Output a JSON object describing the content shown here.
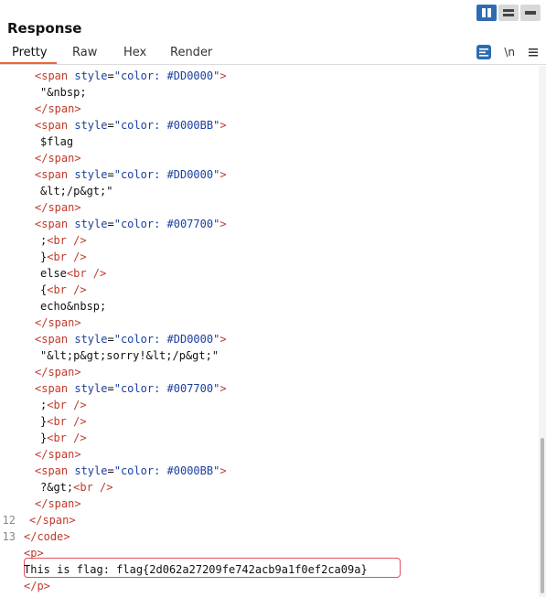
{
  "panel": {
    "title": "Response"
  },
  "layout_buttons": [
    {
      "name": "split-columns"
    },
    {
      "name": "split-rows"
    },
    {
      "name": "single-pane"
    }
  ],
  "tabs": [
    {
      "label": "Pretty",
      "active": true
    },
    {
      "label": "Raw",
      "active": false
    },
    {
      "label": "Hex",
      "active": false
    },
    {
      "label": "Render",
      "active": false
    }
  ],
  "tools": {
    "newline_label": "\\n"
  },
  "code_lines": [
    {
      "ln": "",
      "indent": 2,
      "parts": [
        [
          "tag",
          "<span "
        ],
        [
          "attr",
          "style"
        ],
        [
          "plain",
          "="
        ],
        [
          "str",
          "\"color: #DD0000\""
        ],
        [
          "tag",
          ">"
        ]
      ]
    },
    {
      "ln": "",
      "indent": 3,
      "parts": [
        [
          "txt",
          "\"&nbsp;"
        ]
      ]
    },
    {
      "ln": "",
      "indent": 2,
      "parts": [
        [
          "tag",
          "</span>"
        ]
      ]
    },
    {
      "ln": "",
      "indent": 2,
      "parts": [
        [
          "tag",
          "<span "
        ],
        [
          "attr",
          "style"
        ],
        [
          "plain",
          "="
        ],
        [
          "str",
          "\"color: #0000BB\""
        ],
        [
          "tag",
          ">"
        ]
      ]
    },
    {
      "ln": "",
      "indent": 3,
      "parts": [
        [
          "txt",
          "$flag"
        ]
      ]
    },
    {
      "ln": "",
      "indent": 2,
      "parts": [
        [
          "tag",
          "</span>"
        ]
      ]
    },
    {
      "ln": "",
      "indent": 2,
      "parts": [
        [
          "tag",
          "<span "
        ],
        [
          "attr",
          "style"
        ],
        [
          "plain",
          "="
        ],
        [
          "str",
          "\"color: #DD0000\""
        ],
        [
          "tag",
          ">"
        ]
      ]
    },
    {
      "ln": "",
      "indent": 3,
      "parts": [
        [
          "txt",
          "&lt;/p&gt;\""
        ]
      ]
    },
    {
      "ln": "",
      "indent": 2,
      "parts": [
        [
          "tag",
          "</span>"
        ]
      ]
    },
    {
      "ln": "",
      "indent": 2,
      "parts": [
        [
          "tag",
          "<span "
        ],
        [
          "attr",
          "style"
        ],
        [
          "plain",
          "="
        ],
        [
          "str",
          "\"color: #007700\""
        ],
        [
          "tag",
          ">"
        ]
      ]
    },
    {
      "ln": "",
      "indent": 3,
      "parts": [
        [
          "txt",
          ";"
        ],
        [
          "tag",
          "<br />"
        ]
      ]
    },
    {
      "ln": "",
      "indent": 3,
      "parts": [
        [
          "txt",
          "}"
        ],
        [
          "tag",
          "<br />"
        ]
      ]
    },
    {
      "ln": "",
      "indent": 3,
      "parts": [
        [
          "txt",
          "else"
        ],
        [
          "tag",
          "<br />"
        ]
      ]
    },
    {
      "ln": "",
      "indent": 3,
      "parts": [
        [
          "txt",
          "{"
        ],
        [
          "tag",
          "<br />"
        ]
      ]
    },
    {
      "ln": "",
      "indent": 3,
      "parts": [
        [
          "txt",
          "echo&nbsp;"
        ]
      ]
    },
    {
      "ln": "",
      "indent": 2,
      "parts": [
        [
          "tag",
          "</span>"
        ]
      ]
    },
    {
      "ln": "",
      "indent": 2,
      "parts": [
        [
          "tag",
          "<span "
        ],
        [
          "attr",
          "style"
        ],
        [
          "plain",
          "="
        ],
        [
          "str",
          "\"color: #DD0000\""
        ],
        [
          "tag",
          ">"
        ]
      ]
    },
    {
      "ln": "",
      "indent": 3,
      "parts": [
        [
          "txt",
          "\"&lt;p&gt;sorry!&lt;/p&gt;\""
        ]
      ]
    },
    {
      "ln": "",
      "indent": 2,
      "parts": [
        [
          "tag",
          "</span>"
        ]
      ]
    },
    {
      "ln": "",
      "indent": 2,
      "parts": [
        [
          "tag",
          "<span "
        ],
        [
          "attr",
          "style"
        ],
        [
          "plain",
          "="
        ],
        [
          "str",
          "\"color: #007700\""
        ],
        [
          "tag",
          ">"
        ]
      ]
    },
    {
      "ln": "",
      "indent": 3,
      "parts": [
        [
          "txt",
          ";"
        ],
        [
          "tag",
          "<br />"
        ]
      ]
    },
    {
      "ln": "",
      "indent": 3,
      "parts": [
        [
          "txt",
          "}"
        ],
        [
          "tag",
          "<br />"
        ]
      ]
    },
    {
      "ln": "",
      "indent": 3,
      "parts": [
        [
          "txt",
          "}"
        ],
        [
          "tag",
          "<br />"
        ]
      ]
    },
    {
      "ln": "",
      "indent": 2,
      "parts": [
        [
          "tag",
          "</span>"
        ]
      ]
    },
    {
      "ln": "",
      "indent": 2,
      "parts": [
        [
          "tag",
          "<span "
        ],
        [
          "attr",
          "style"
        ],
        [
          "plain",
          "="
        ],
        [
          "str",
          "\"color: #0000BB\""
        ],
        [
          "tag",
          ">"
        ]
      ]
    },
    {
      "ln": "",
      "indent": 3,
      "parts": [
        [
          "txt",
          "?&gt;"
        ],
        [
          "tag",
          "<br />"
        ]
      ]
    },
    {
      "ln": "",
      "indent": 2,
      "parts": [
        [
          "tag",
          "</span>"
        ]
      ]
    },
    {
      "ln": "12",
      "indent": 1,
      "parts": [
        [
          "tag",
          "</span>"
        ]
      ]
    },
    {
      "ln": "13",
      "indent": 0,
      "parts": [
        [
          "tag",
          "</code>"
        ]
      ]
    },
    {
      "ln": "",
      "indent": 0,
      "parts": [
        [
          "tag",
          "<p>"
        ]
      ]
    },
    {
      "ln": "",
      "indent": 0,
      "parts": [
        [
          "txt",
          "This is flag: flag{2d062a27209fe742acb9a1f0ef2ca09a}"
        ]
      ]
    },
    {
      "ln": "",
      "indent": 0,
      "parts": [
        [
          "tag",
          "</p>"
        ]
      ]
    }
  ]
}
